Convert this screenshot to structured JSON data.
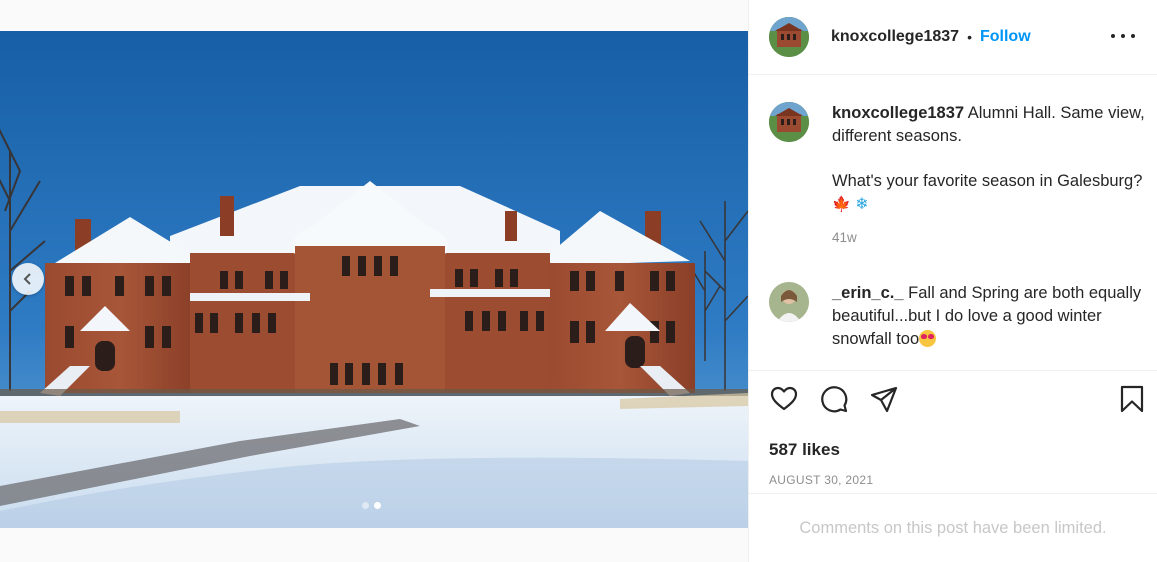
{
  "post": {
    "username": "knoxcollege1837",
    "separator": "•",
    "follow_label": "Follow",
    "more_icon": "more-horizontal-icon",
    "carousel": {
      "total_slides": 2,
      "active_slide": 2
    },
    "prev_icon": "chevron-left-icon"
  },
  "caption": {
    "username": "knoxcollege1837",
    "line1": "Alumni Hall. Same view, different seasons.",
    "line2": "What's your favorite season in Galesburg?",
    "emoji1": "🍁",
    "emoji2": "❄",
    "time": "41w"
  },
  "comment": {
    "username": "_erin_c._",
    "text": "Fall and Spring are both equally beautiful...but I do love a good winter snowfall too"
  },
  "actions": {
    "like_icon": "heart-icon",
    "comment_icon": "comment-bubble-icon",
    "share_icon": "paper-plane-icon",
    "save_icon": "bookmark-icon"
  },
  "likes": "587 likes",
  "date": "AUGUST 30, 2021",
  "comments_limited": "Comments on this post have been limited.",
  "colors": {
    "link_blue": "#0095f6",
    "muted": "#8e8e8e",
    "limited_text": "#c7c7c7"
  }
}
